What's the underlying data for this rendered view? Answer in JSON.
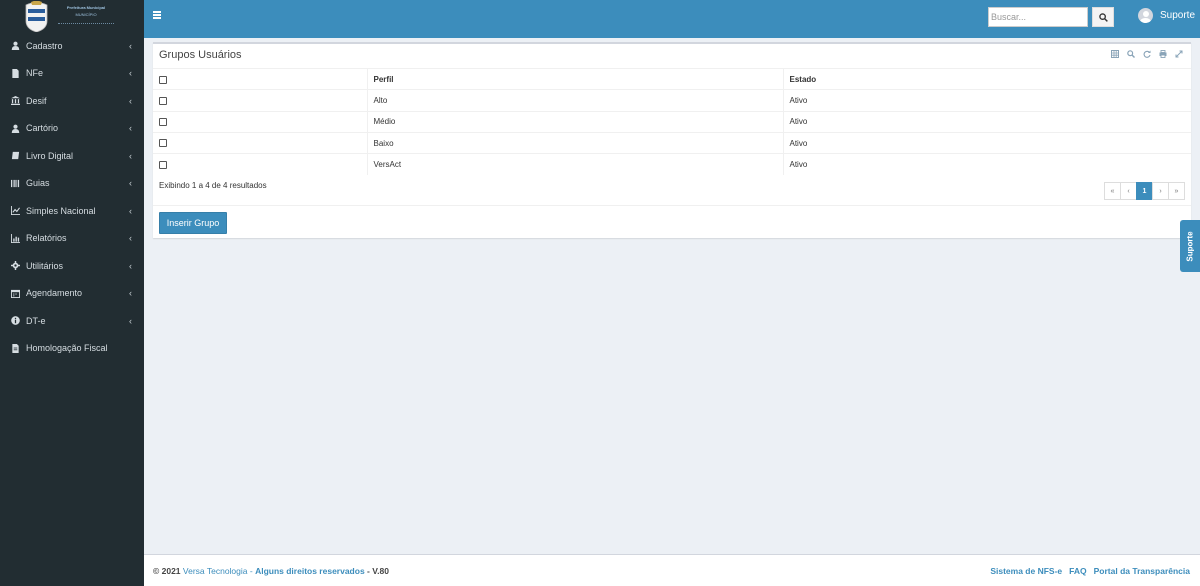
{
  "logo": {
    "line1": "Prefeitura Municipal",
    "line2": "MUNICÍPIO"
  },
  "sidebar": {
    "items": [
      {
        "label": "Cadastro",
        "icon": "user-icon",
        "has_children": true
      },
      {
        "label": "NFe",
        "icon": "file-icon",
        "has_children": true
      },
      {
        "label": "Desif",
        "icon": "bank-icon",
        "has_children": true
      },
      {
        "label": "Cartório",
        "icon": "user-icon",
        "has_children": true
      },
      {
        "label": "Livro Digital",
        "icon": "book-icon",
        "has_children": true
      },
      {
        "label": "Guias",
        "icon": "barcode-icon",
        "has_children": true
      },
      {
        "label": "Simples Nacional",
        "icon": "line-chart-icon",
        "has_children": true
      },
      {
        "label": "Relatórios",
        "icon": "bar-chart-icon",
        "has_children": true
      },
      {
        "label": "Utilitários",
        "icon": "gear-icon",
        "has_children": true
      },
      {
        "label": "Agendamento",
        "icon": "calendar-icon",
        "has_children": true
      },
      {
        "label": "DT-e",
        "icon": "info-icon",
        "has_children": true
      },
      {
        "label": "Homologação Fiscal",
        "icon": "file-text-icon",
        "has_children": false
      }
    ],
    "chevron": "‹"
  },
  "header": {
    "search_placeholder": "Buscar...",
    "user_name": "Suporte"
  },
  "box": {
    "title": "Grupos Usuários",
    "columns": [
      "Perfil",
      "Estado"
    ],
    "rows": [
      {
        "perfil": "Alto",
        "estado": "Ativo"
      },
      {
        "perfil": "Médio",
        "estado": "Ativo"
      },
      {
        "perfil": "Baixo",
        "estado": "Ativo"
      },
      {
        "perfil": "VersAct",
        "estado": "Ativo"
      }
    ],
    "result_text": "Exibindo 1 a 4 de 4 resultados",
    "pagination": {
      "first": "«",
      "prev": "‹",
      "current": "1",
      "next": "›",
      "last": "»"
    },
    "insert_button": "Inserir Grupo"
  },
  "support_tab": "Suporte",
  "footer": {
    "copyright": "© 2021",
    "company": "Versa Tecnologia",
    "separator": " - ",
    "rights": "Alguns direitos reservados",
    "version_sep": " - ",
    "version": "V.80",
    "links": [
      "Sistema de NFS-e",
      "FAQ",
      "Portal da Transparência"
    ]
  },
  "colors": {
    "primary": "#3c8dbc",
    "sidebar_bg": "#222d32",
    "content_bg": "#ecf0f5"
  }
}
